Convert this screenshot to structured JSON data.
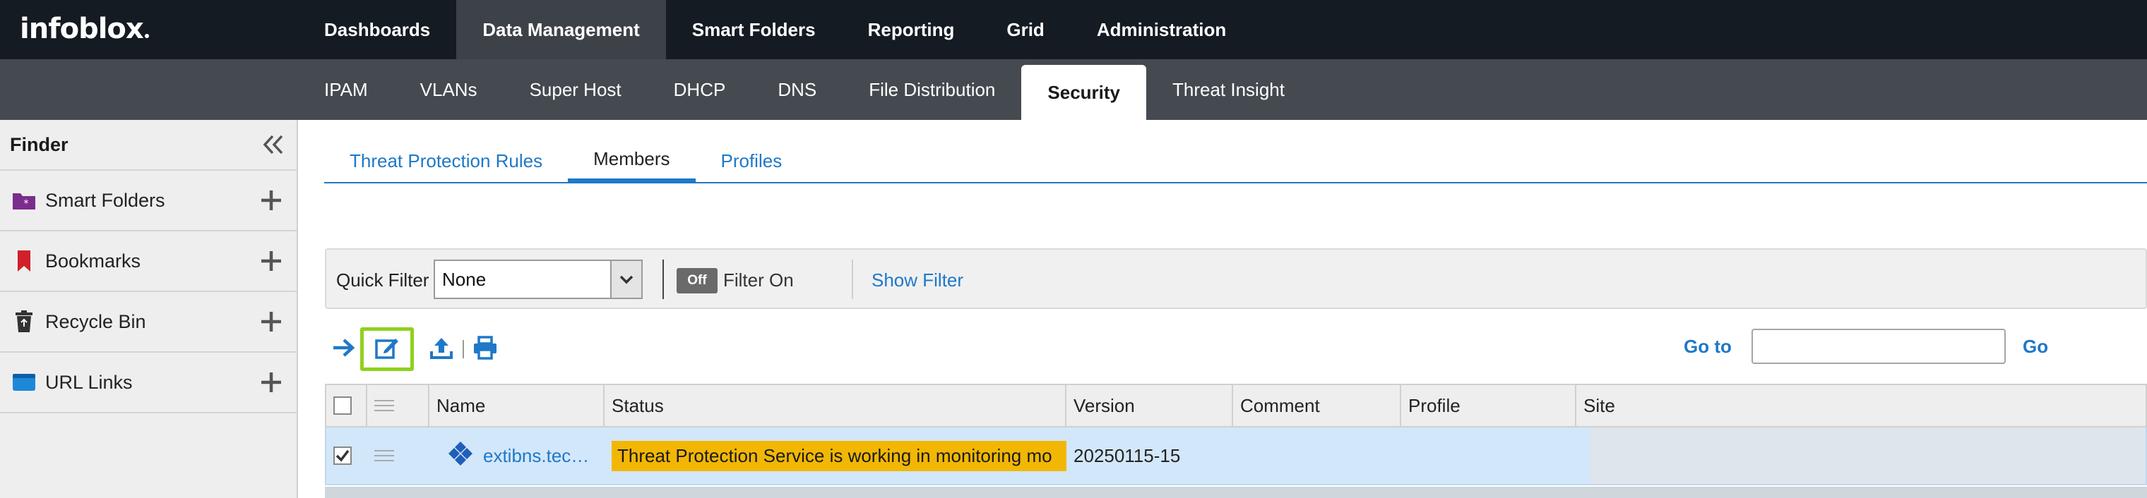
{
  "brand": {
    "logo_text": "infoblox"
  },
  "main_nav": [
    {
      "label": "Dashboards",
      "active": false
    },
    {
      "label": "Data Management",
      "active": true
    },
    {
      "label": "Smart Folders",
      "active": false
    },
    {
      "label": "Reporting",
      "active": false
    },
    {
      "label": "Grid",
      "active": false
    },
    {
      "label": "Administration",
      "active": false
    }
  ],
  "sub_nav": [
    {
      "label": "IPAM",
      "active": false
    },
    {
      "label": "VLANs",
      "active": false
    },
    {
      "label": "Super Host",
      "active": false
    },
    {
      "label": "DHCP",
      "active": false
    },
    {
      "label": "DNS",
      "active": false
    },
    {
      "label": "File Distribution",
      "active": false
    },
    {
      "label": "Security",
      "active": true
    },
    {
      "label": "Threat Insight",
      "active": false
    }
  ],
  "finder": {
    "title": "Finder",
    "items": [
      {
        "label": "Smart Folders",
        "icon": "smart-folder-icon"
      },
      {
        "label": "Bookmarks",
        "icon": "bookmark-icon"
      },
      {
        "label": "Recycle Bin",
        "icon": "recycle-bin-icon"
      },
      {
        "label": "URL Links",
        "icon": "url-links-icon"
      }
    ]
  },
  "tabs": [
    {
      "label": "Threat Protection Rules",
      "active": false
    },
    {
      "label": "Members",
      "active": true
    },
    {
      "label": "Profiles",
      "active": false
    }
  ],
  "filter": {
    "quick_filter_label": "Quick Filter",
    "quick_filter_value": "None",
    "toggle_label": "Off",
    "filter_on_label": "Filter On",
    "show_filter_label": "Show Filter"
  },
  "goto": {
    "label": "Go to",
    "value": "",
    "button": "Go"
  },
  "table": {
    "columns": [
      "Name",
      "Status",
      "Version",
      "Comment",
      "Profile",
      "Site"
    ],
    "rows": [
      {
        "checked": true,
        "name": "extibns.tec…",
        "status": "Threat Protection Service is working in monitoring mo",
        "version": "20250115-15",
        "comment": "",
        "profile": "",
        "site": ""
      }
    ]
  },
  "colors": {
    "accent": "#1f78c8",
    "topbar": "#141b22",
    "subbar": "#454a50",
    "status_warning": "#f2b705",
    "selected_row": "#d3e7fa",
    "highlight": "#8fd11e"
  }
}
